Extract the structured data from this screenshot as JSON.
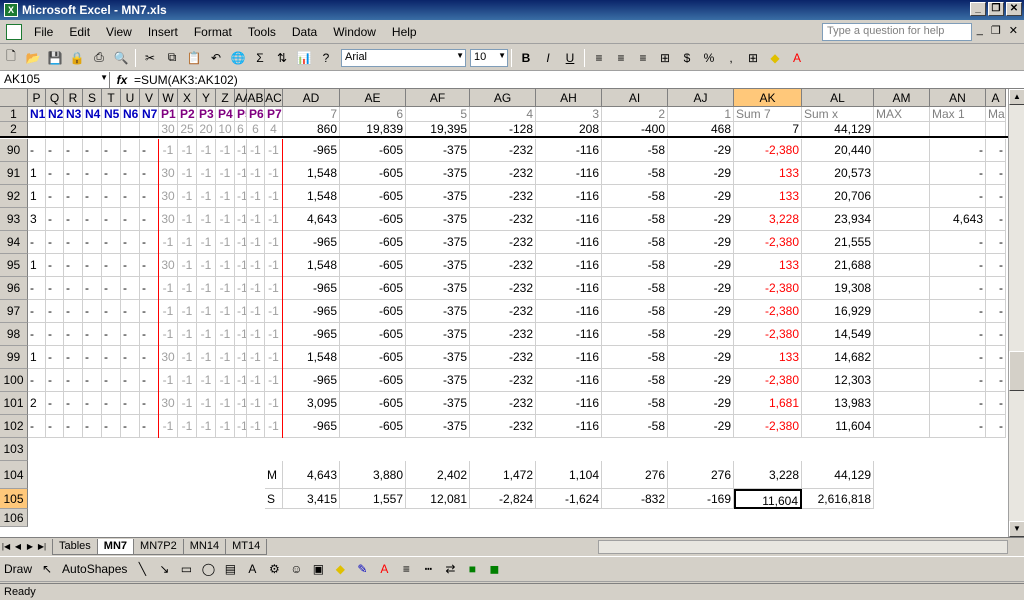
{
  "window": {
    "title": "Microsoft Excel - MN7.xls"
  },
  "menu": {
    "items": [
      "File",
      "Edit",
      "View",
      "Insert",
      "Format",
      "Tools",
      "Data",
      "Window",
      "Help"
    ],
    "ask_placeholder": "Type a question for help"
  },
  "toolbar": {
    "font": "Arial",
    "size": "10",
    "bold": "B",
    "italic": "I",
    "underline": "U",
    "currency": "$",
    "percent": "%",
    "sigma": "Σ"
  },
  "formula_bar": {
    "name_box": "AK105",
    "fx": "fx",
    "formula": "=SUM(AK3:AK102)"
  },
  "columns": [
    "P",
    "Q",
    "R",
    "S",
    "T",
    "U",
    "V",
    "W",
    "X",
    "Y",
    "Z",
    "AA",
    "AB",
    "AC",
    "AD",
    "AE",
    "AF",
    "AG",
    "AH",
    "AI",
    "AJ",
    "AK",
    "AL",
    "AM",
    "AN",
    "A"
  ],
  "rows": {
    "r1": {
      "num": "1",
      "cells": [
        "N1",
        "N2",
        "N3",
        "N4",
        "N5",
        "N6",
        "N7",
        "P1",
        "P2",
        "P3",
        "P4",
        "P5",
        "P6",
        "P7",
        "7",
        "6",
        "5",
        "4",
        "3",
        "2",
        "1",
        "Sum 7",
        "Sum x",
        "MAX",
        "Max 1",
        "Max"
      ]
    },
    "r2": {
      "num": "2",
      "cells": [
        "",
        "",
        "",
        "",
        "",
        "",
        "",
        "30",
        "25",
        "20",
        "10",
        "6",
        "6",
        "4",
        "860",
        "19,839",
        "19,395",
        "-128",
        "208",
        "-400",
        "468",
        "7",
        "44,129",
        "",
        "",
        ""
      ]
    },
    "data": [
      {
        "num": "90",
        "n": [
          "-",
          "-",
          "-",
          "-",
          "-",
          "-",
          "-"
        ],
        "p": [
          "-1",
          "-1",
          "-1",
          "-1",
          "-1",
          "-1",
          "-1"
        ],
        "v": [
          "-965",
          "-605",
          "-375",
          "-232",
          "-116",
          "-58",
          "-29",
          "-2,380",
          "20,440",
          "",
          "-",
          "-"
        ]
      },
      {
        "num": "91",
        "n": [
          "1",
          "-",
          "-",
          "-",
          "-",
          "-",
          "-"
        ],
        "p": [
          "30",
          "-1",
          "-1",
          "-1",
          "-1",
          "-1",
          "-1"
        ],
        "v": [
          "1,548",
          "-605",
          "-375",
          "-232",
          "-116",
          "-58",
          "-29",
          "133",
          "20,573",
          "",
          "-",
          "-"
        ]
      },
      {
        "num": "92",
        "n": [
          "1",
          "-",
          "-",
          "-",
          "-",
          "-",
          "-"
        ],
        "p": [
          "30",
          "-1",
          "-1",
          "-1",
          "-1",
          "-1",
          "-1"
        ],
        "v": [
          "1,548",
          "-605",
          "-375",
          "-232",
          "-116",
          "-58",
          "-29",
          "133",
          "20,706",
          "",
          "-",
          "-"
        ]
      },
      {
        "num": "93",
        "n": [
          "3",
          "-",
          "-",
          "-",
          "-",
          "-",
          "-"
        ],
        "p": [
          "30",
          "-1",
          "-1",
          "-1",
          "-1",
          "-1",
          "-1"
        ],
        "v": [
          "4,643",
          "-605",
          "-375",
          "-232",
          "-116",
          "-58",
          "-29",
          "3,228",
          "23,934",
          "",
          "4,643",
          "-"
        ]
      },
      {
        "num": "94",
        "n": [
          "-",
          "-",
          "-",
          "-",
          "-",
          "-",
          "-"
        ],
        "p": [
          "-1",
          "-1",
          "-1",
          "-1",
          "-1",
          "-1",
          "-1"
        ],
        "v": [
          "-965",
          "-605",
          "-375",
          "-232",
          "-116",
          "-58",
          "-29",
          "-2,380",
          "21,555",
          "",
          "-",
          "-"
        ]
      },
      {
        "num": "95",
        "n": [
          "1",
          "-",
          "-",
          "-",
          "-",
          "-",
          "-"
        ],
        "p": [
          "30",
          "-1",
          "-1",
          "-1",
          "-1",
          "-1",
          "-1"
        ],
        "v": [
          "1,548",
          "-605",
          "-375",
          "-232",
          "-116",
          "-58",
          "-29",
          "133",
          "21,688",
          "",
          "-",
          "-"
        ]
      },
      {
        "num": "96",
        "n": [
          "-",
          "-",
          "-",
          "-",
          "-",
          "-",
          "-"
        ],
        "p": [
          "-1",
          "-1",
          "-1",
          "-1",
          "-1",
          "-1",
          "-1"
        ],
        "v": [
          "-965",
          "-605",
          "-375",
          "-232",
          "-116",
          "-58",
          "-29",
          "-2,380",
          "19,308",
          "",
          "-",
          "-"
        ]
      },
      {
        "num": "97",
        "n": [
          "-",
          "-",
          "-",
          "-",
          "-",
          "-",
          "-"
        ],
        "p": [
          "-1",
          "-1",
          "-1",
          "-1",
          "-1",
          "-1",
          "-1"
        ],
        "v": [
          "-965",
          "-605",
          "-375",
          "-232",
          "-116",
          "-58",
          "-29",
          "-2,380",
          "16,929",
          "",
          "-",
          "-"
        ]
      },
      {
        "num": "98",
        "n": [
          "-",
          "-",
          "-",
          "-",
          "-",
          "-",
          "-"
        ],
        "p": [
          "-1",
          "-1",
          "-1",
          "-1",
          "-1",
          "-1",
          "-1"
        ],
        "v": [
          "-965",
          "-605",
          "-375",
          "-232",
          "-116",
          "-58",
          "-29",
          "-2,380",
          "14,549",
          "",
          "-",
          "-"
        ]
      },
      {
        "num": "99",
        "n": [
          "1",
          "-",
          "-",
          "-",
          "-",
          "-",
          "-"
        ],
        "p": [
          "30",
          "-1",
          "-1",
          "-1",
          "-1",
          "-1",
          "-1"
        ],
        "v": [
          "1,548",
          "-605",
          "-375",
          "-232",
          "-116",
          "-58",
          "-29",
          "133",
          "14,682",
          "",
          "-",
          "-"
        ]
      },
      {
        "num": "100",
        "n": [
          "-",
          "-",
          "-",
          "-",
          "-",
          "-",
          "-"
        ],
        "p": [
          "-1",
          "-1",
          "-1",
          "-1",
          "-1",
          "-1",
          "-1"
        ],
        "v": [
          "-965",
          "-605",
          "-375",
          "-232",
          "-116",
          "-58",
          "-29",
          "-2,380",
          "12,303",
          "",
          "-",
          "-"
        ]
      },
      {
        "num": "101",
        "n": [
          "2",
          "-",
          "-",
          "-",
          "-",
          "-",
          "-"
        ],
        "p": [
          "30",
          "-1",
          "-1",
          "-1",
          "-1",
          "-1",
          "-1"
        ],
        "v": [
          "3,095",
          "-605",
          "-375",
          "-232",
          "-116",
          "-58",
          "-29",
          "1,681",
          "13,983",
          "",
          "-",
          "-"
        ]
      },
      {
        "num": "102",
        "n": [
          "-",
          "-",
          "-",
          "-",
          "-",
          "-",
          "-"
        ],
        "p": [
          "-1",
          "-1",
          "-1",
          "-1",
          "-1",
          "-1",
          "-1"
        ],
        "v": [
          "-965",
          "-605",
          "-375",
          "-232",
          "-116",
          "-58",
          "-29",
          "-2,380",
          "11,604",
          "",
          "-",
          "-"
        ]
      }
    ],
    "r103": {
      "num": "103"
    },
    "r104": {
      "num": "104",
      "label": "M",
      "v": [
        "4,643",
        "3,880",
        "2,402",
        "1,472",
        "1,104",
        "276",
        "276",
        "3,228",
        "44,129"
      ]
    },
    "r105": {
      "num": "105",
      "label": "S",
      "v": [
        "3,415",
        "1,557",
        "12,081",
        "-2,824",
        "-1,624",
        "-832",
        "-169",
        "11,604",
        "2,616,818"
      ]
    },
    "r106": {
      "num": "106"
    }
  },
  "sheets": [
    "Tables",
    "MN7",
    "MN7P2",
    "MN14",
    "MT14"
  ],
  "active_sheet": "MN7",
  "drawing": {
    "draw": "Draw",
    "autoshapes": "AutoShapes"
  },
  "status": "Ready",
  "colors": {
    "title_bar": "#0a246a",
    "n_header": "#0000c0",
    "p_header": "#800080",
    "negative_red": "#ff0000",
    "selection": "#ffc87a"
  }
}
